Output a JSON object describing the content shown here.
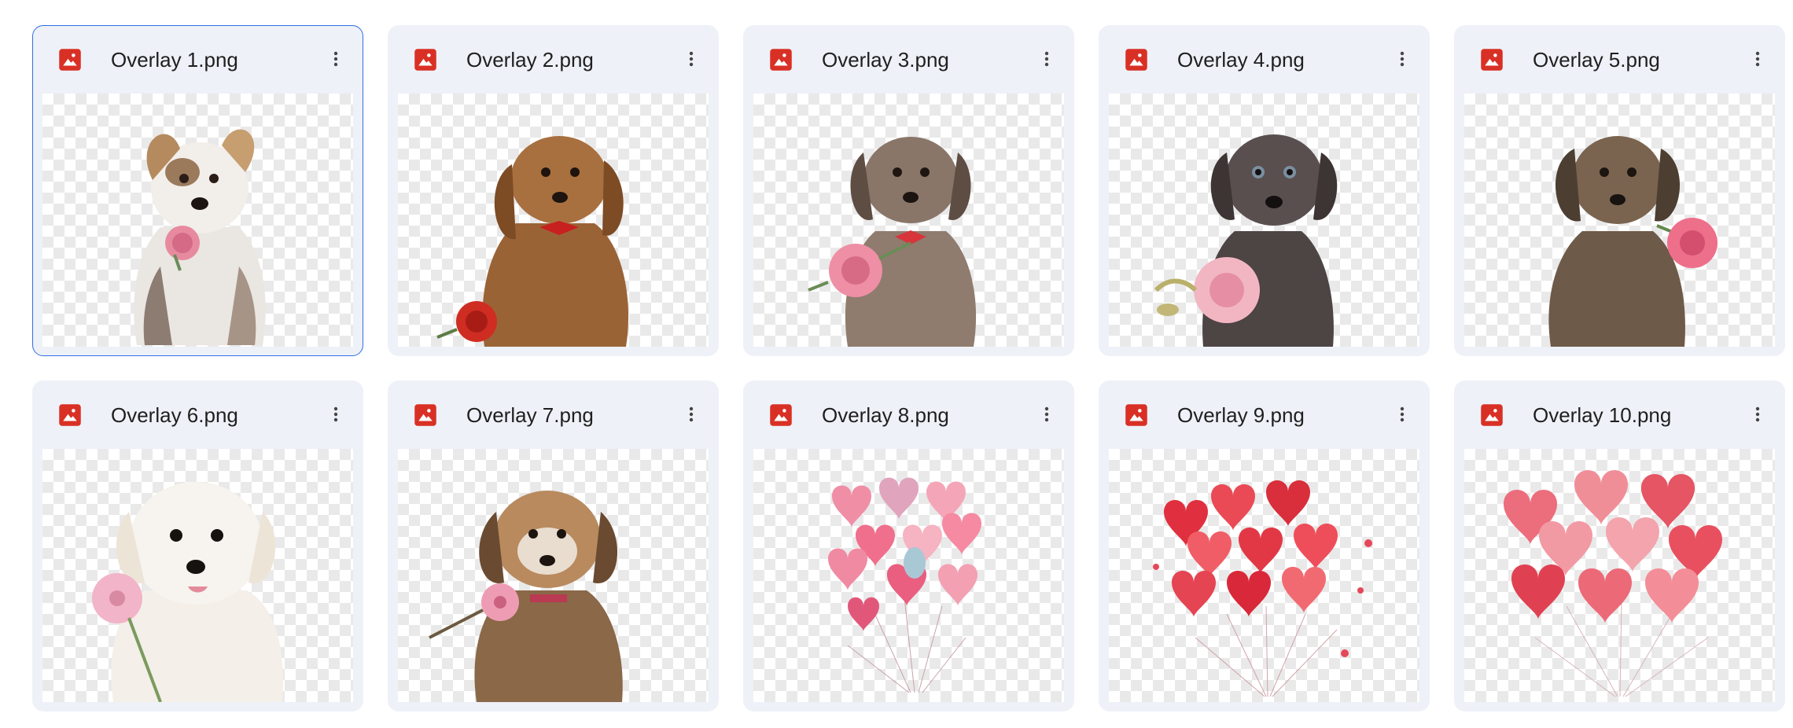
{
  "files": [
    {
      "name": "Overlay 1.png",
      "selected": true
    },
    {
      "name": "Overlay 2.png"
    },
    {
      "name": "Overlay 3.png"
    },
    {
      "name": "Overlay 4.png"
    },
    {
      "name": "Overlay 5.png"
    },
    {
      "name": "Overlay 6.png"
    },
    {
      "name": "Overlay 7.png"
    },
    {
      "name": "Overlay 8.png"
    },
    {
      "name": "Overlay 9.png"
    },
    {
      "name": "Overlay 10.png"
    }
  ],
  "icons": {
    "file_type": "image-file-icon",
    "menu": "more-vert-icon"
  },
  "colors": {
    "card_bg": "#eef1f7",
    "selected_border": "#2f6fe4",
    "image_icon": "#d93025",
    "text": "#1f1f1f"
  }
}
